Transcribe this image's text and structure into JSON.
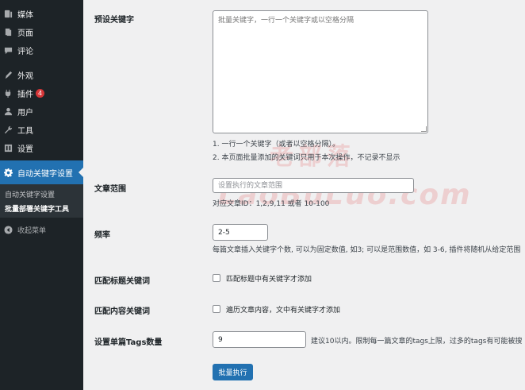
{
  "sidebar": {
    "items": [
      {
        "label": "媒体",
        "icon": "media-icon"
      },
      {
        "label": "页面",
        "icon": "pages-icon"
      },
      {
        "label": "评论",
        "icon": "comments-icon"
      },
      {
        "label": "外观",
        "icon": "appearance-icon"
      },
      {
        "label": "插件",
        "icon": "plugins-icon",
        "badge": "4"
      },
      {
        "label": "用户",
        "icon": "users-icon"
      },
      {
        "label": "工具",
        "icon": "tools-icon"
      },
      {
        "label": "设置",
        "icon": "settings-icon"
      }
    ],
    "active": {
      "label": "自动关键字设置",
      "icon": "gear-icon"
    },
    "submenu": [
      {
        "label": "自动关键字设置"
      },
      {
        "label": "批量部署关键字工具",
        "current": true
      }
    ],
    "collapse_label": "收起菜单"
  },
  "form": {
    "preset_keywords": {
      "label": "预设关键字",
      "placeholder": "批量关键字，一行一个关键字或以空格分隔",
      "help_1": "1. 一行一个关键字（或者以空格分隔）。",
      "help_2": "2. 本页面批量添加的关键词只用于本次操作，不记录不显示"
    },
    "article_range": {
      "label": "文章范围",
      "placeholder": "设置执行的文章范围",
      "help": "对应文章ID：1,2,9,11 或者 10-100"
    },
    "frequency": {
      "label": "频率",
      "value": "2-5",
      "help": "每篇文章插入关键字个数, 可以为固定数值, 如3; 可以是范围数值，如 3-6, 插件将随机从给定范围"
    },
    "match_title": {
      "label": "匹配标题关键词",
      "checkbox_label": "匹配标题中有关键字才添加",
      "checked": false
    },
    "match_content": {
      "label": "匹配内容关键词",
      "checkbox_label": "遍历文章内容，文中有关键字才添加",
      "checked": false
    },
    "tags_count": {
      "label": "设置单篇Tags数量",
      "value": "9",
      "help": "建议10以内。限制每一篇文章的tags上限，过多的tags有可能被搜"
    },
    "submit_label": "批量执行"
  },
  "watermark": {
    "line1": "老部落",
    "line2": "LaoBuLuo.com"
  },
  "colors": {
    "sidebar_bg": "#1d2327",
    "accent": "#2271b1",
    "badge": "#d63638"
  }
}
